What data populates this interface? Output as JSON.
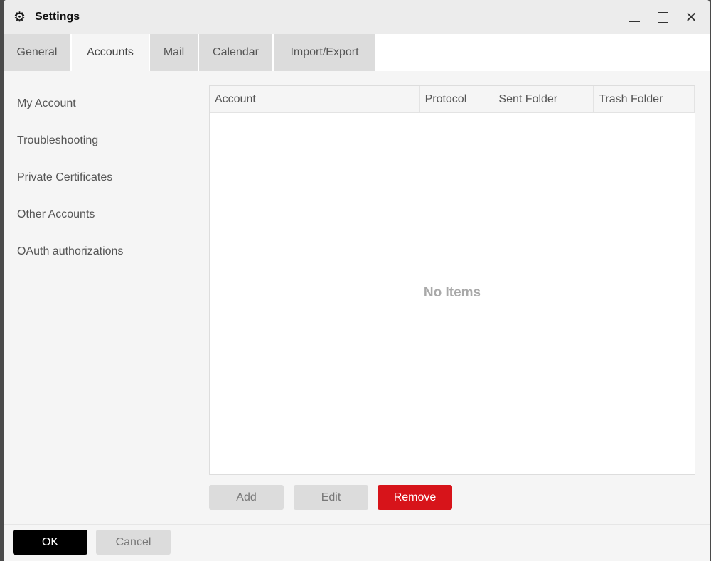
{
  "window": {
    "title": "Settings",
    "icon": "gear-icon"
  },
  "tabs": [
    "General",
    "Accounts",
    "Mail",
    "Calendar",
    "Import/Export"
  ],
  "active_tab": "Accounts",
  "sidebar": {
    "items": [
      "My Account",
      "Troubleshooting",
      "Private Certificates",
      "Other Accounts",
      "OAuth authorizations"
    ]
  },
  "table": {
    "columns": [
      "Account",
      "Protocol",
      "Sent Folder",
      "Trash Folder"
    ],
    "rows": [],
    "empty_text": "No Items"
  },
  "actions": {
    "add": "Add",
    "edit": "Edit",
    "remove": "Remove"
  },
  "footer": {
    "ok": "OK",
    "cancel": "Cancel"
  },
  "colors": {
    "danger": "#d7141a",
    "primary": "#000000"
  }
}
